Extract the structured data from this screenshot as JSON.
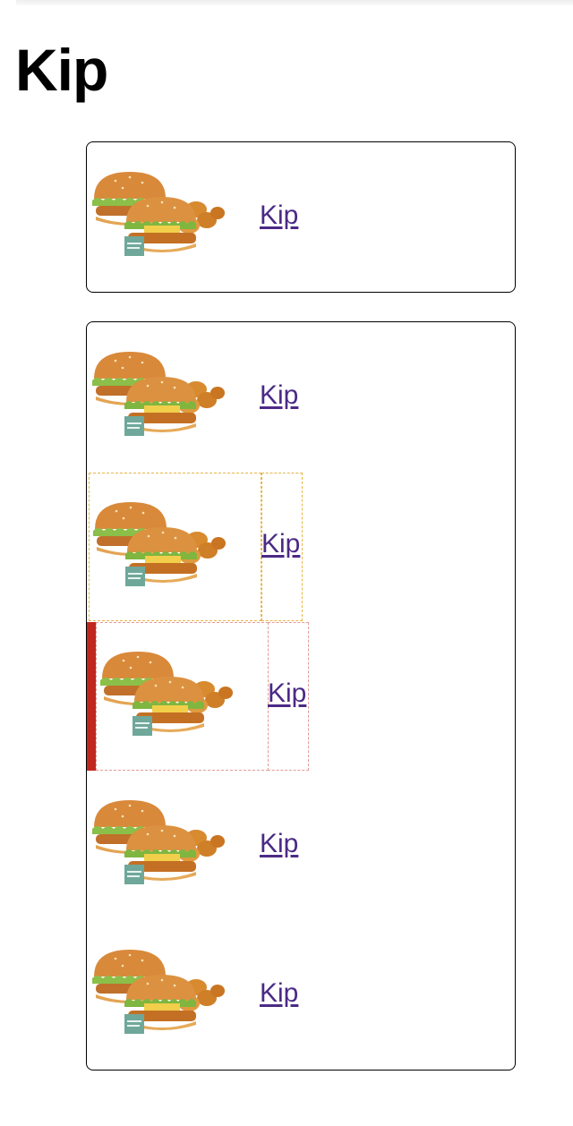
{
  "page": {
    "title": "Kip"
  },
  "card1": {
    "items": [
      {
        "label": "Kip",
        "image_alt": "Kip burger menu"
      }
    ]
  },
  "card2": {
    "items": [
      {
        "label": "Kip",
        "image_alt": "Kip burger menu"
      },
      {
        "label": "Kip",
        "image_alt": "Kip burger menu"
      },
      {
        "label": "Kip",
        "image_alt": "Kip burger menu"
      },
      {
        "label": "Kip",
        "image_alt": "Kip burger menu"
      },
      {
        "label": "Kip",
        "image_alt": "Kip burger menu"
      }
    ]
  },
  "colors": {
    "link": "#4b2a86",
    "hover_outline": "#e8b649",
    "focus_bar": "#c0281f",
    "focus_outline": "#e49b98"
  }
}
